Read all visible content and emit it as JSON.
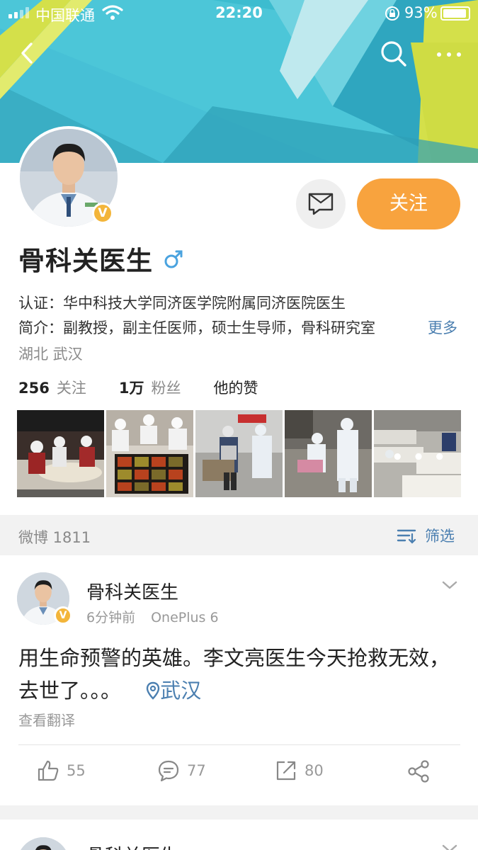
{
  "status_bar": {
    "carrier": "中国联通",
    "time": "22:20",
    "battery": "93%",
    "battery_level": 0.93
  },
  "icons": {
    "back": "back-arrow-icon",
    "search": "search-icon",
    "more": "more-dots-icon",
    "message": "message-icon",
    "gender": "male-icon",
    "filter": "filter-icon",
    "chevron": "chevron-down-icon",
    "like": "thumbs-up-icon",
    "comment": "comment-icon",
    "repost": "repost-icon",
    "share": "share-icon",
    "location": "location-pin-icon"
  },
  "colors": {
    "accent_orange": "#f8a33e",
    "link_blue": "#4b7fb0",
    "verified_gold": "#f3b53a",
    "banner_cyan": "#4cc6d8",
    "banner_yellow": "#d4e04a"
  },
  "profile": {
    "name": "骨科关医生",
    "verified_badge": "V",
    "follow_label": "关注",
    "verification": "认证：华中科技大学同济医学院附属同济医院医生",
    "bio": "简介：副教授，副主任医师，硕士生导师，骨科研究室",
    "bio_more": "更多",
    "location": "湖北 武汉"
  },
  "stats": {
    "following_count": "256",
    "following_label": "关注",
    "followers_count": "1万",
    "followers_label": "粉丝",
    "likes_label": "他的赞"
  },
  "photos": {
    "more": "• • •"
  },
  "feed": {
    "post_count": "微博 1811",
    "filter_label": "筛选"
  },
  "post": {
    "author": "骨科关医生",
    "verified_badge": "V",
    "time": "6分钟前",
    "device": "OnePlus 6",
    "text": "用生命预警的英雄。李文亮医生今天抢救无效，去世了。。。",
    "location": "武汉",
    "translate": "查看翻译",
    "likes": "55",
    "comments": "77",
    "reposts": "80"
  },
  "post2": {
    "author": "骨科关医生"
  }
}
